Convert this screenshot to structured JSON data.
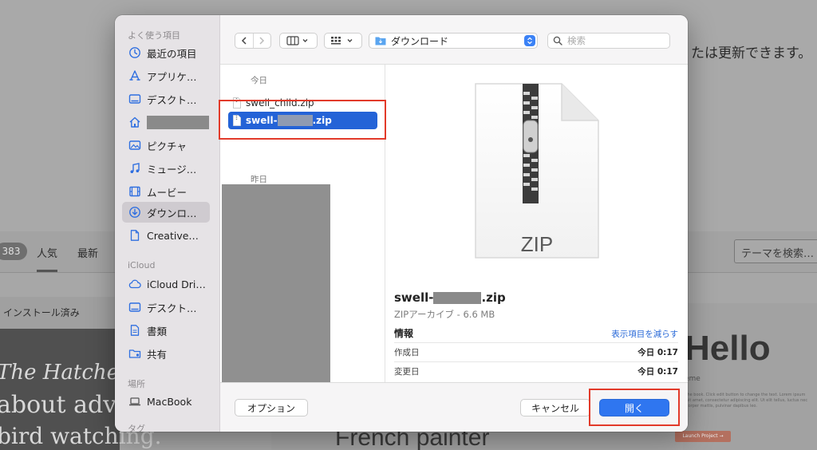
{
  "background": {
    "notice_text": "たは更新できます。",
    "theme_count": "383",
    "tabs": [
      "人気",
      "最新"
    ],
    "search_placeholder": "テーマを検索…",
    "installed_label": "インストール済み",
    "card1_lines": [
      "The Hatcher",
      "about adve",
      "bird watching."
    ],
    "card2_text": "French painter",
    "card3_title": "Hello",
    "card3_sub": "eme",
    "card3_button": "Launch Project →",
    "card3_lorem": "Click the book. Click edit button to change the text. Lorem ipsum dolor sit amet, consectetur adipiscing elit. Ut elit tellus, luctus nec ullamcorper mattis, pulvinar dapibus leo."
  },
  "sidebar": {
    "favorites_header": "よく使う項目",
    "favorites": [
      {
        "label": "最近の項目",
        "icon": "clock-icon"
      },
      {
        "label": "アプリケ…",
        "icon": "applications-icon"
      },
      {
        "label": "デスクト…",
        "icon": "desktop-icon"
      },
      {
        "label": "",
        "icon": "home-icon"
      },
      {
        "label": "ピクチャ",
        "icon": "photo-icon"
      },
      {
        "label": "ミュージ…",
        "icon": "music-icon"
      },
      {
        "label": "ムービー",
        "icon": "film-icon"
      },
      {
        "label": "ダウンロ…",
        "icon": "download-icon"
      },
      {
        "label": "Creative…",
        "icon": "document-icon"
      }
    ],
    "icloud_header": "iCloud",
    "icloud": [
      {
        "label": "iCloud Dri…",
        "icon": "cloud-icon"
      },
      {
        "label": "デスクト…",
        "icon": "desktop-icon"
      },
      {
        "label": "書類",
        "icon": "document-icon"
      },
      {
        "label": "共有",
        "icon": "shared-folder-icon"
      }
    ],
    "locations_header": "場所",
    "locations": [
      {
        "label": "MacBook",
        "icon": "laptop-icon"
      }
    ],
    "tags_header": "タグ"
  },
  "toolbar": {
    "location": "ダウンロード",
    "search_placeholder": "検索"
  },
  "filelist": {
    "today_header": "今日",
    "yesterday_header": "昨日",
    "files": [
      {
        "name_prefix": "swell_child.zip",
        "name_suffix": ""
      },
      {
        "name_prefix": "swell-",
        "name_suffix": ".zip"
      }
    ]
  },
  "preview": {
    "icon_label": "ZIP",
    "name_prefix": "swell-",
    "name_suffix": ".zip",
    "kind": "ZIPアーカイブ - 6.6 MB",
    "info_header": "情報",
    "show_less": "表示項目を減らす",
    "rows": [
      {
        "label": "作成日",
        "value": "今日 0:17"
      },
      {
        "label": "変更日",
        "value": "今日 0:17"
      }
    ]
  },
  "footer": {
    "options": "オプション",
    "cancel": "キャンセル",
    "open": "開く"
  },
  "colors": {
    "accent": "#2f76f0",
    "selection": "#2463d7",
    "annotation": "#e23a2a"
  }
}
